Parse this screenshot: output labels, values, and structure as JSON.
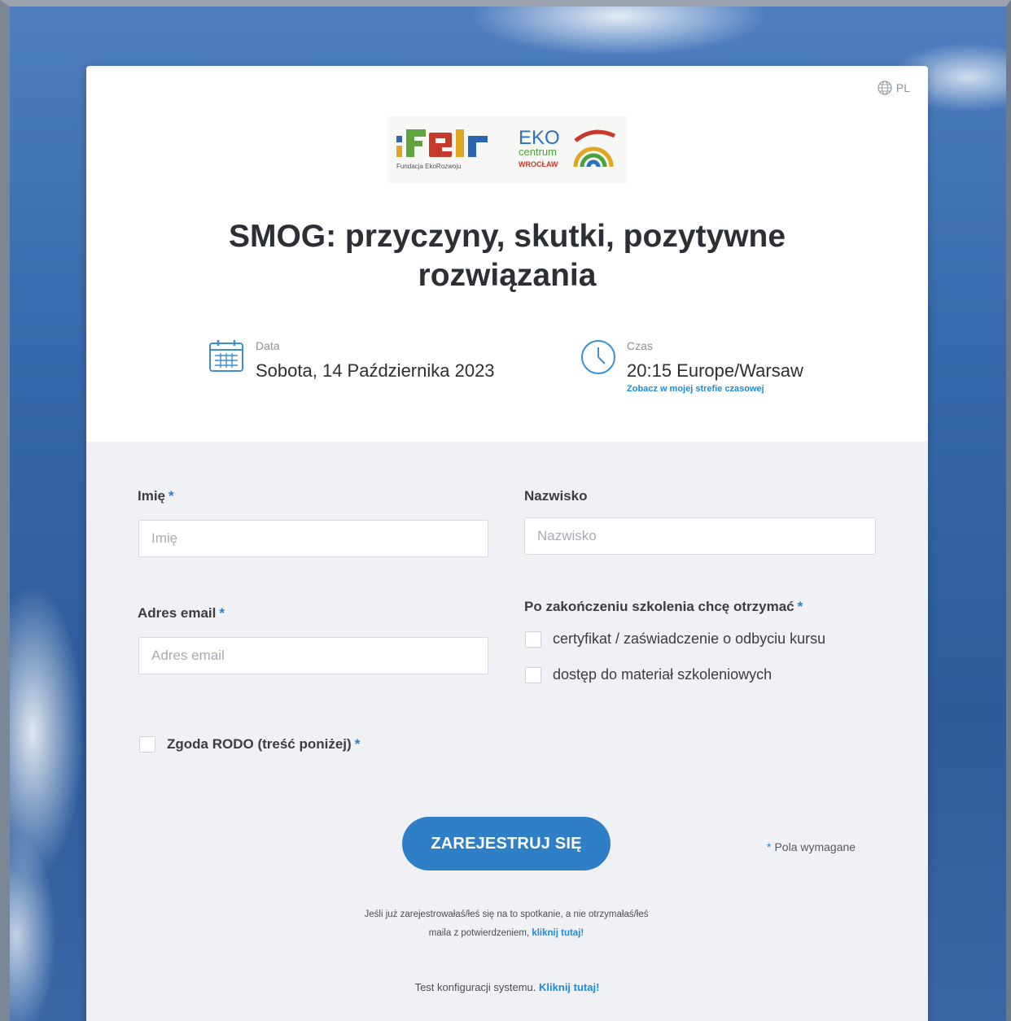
{
  "header": {
    "language": "PL",
    "logo_left_caption": "Fundacja EkoRozwoju",
    "logo_right_text": "EKO",
    "logo_right_sub": "centrum",
    "logo_right_city": "WROCŁAW"
  },
  "event": {
    "title": "SMOG: przyczyny, skutki, pozytywne rozwiązania",
    "date_label": "Data",
    "date_value": "Sobota, 14 Października 2023",
    "time_label": "Czas",
    "time_value": "20:15 Europe/Warsaw",
    "timezone_link": "Zobacz w mojej strefie czasowej"
  },
  "form": {
    "first_name": {
      "label": "Imię",
      "required": "*",
      "placeholder": "Imię",
      "value": ""
    },
    "last_name": {
      "label": "Nazwisko",
      "placeholder": "Nazwisko",
      "value": ""
    },
    "email": {
      "label": "Adres email",
      "required": "*",
      "placeholder": "Adres email",
      "value": ""
    },
    "after_training": {
      "label": "Po zakończeniu szkolenia chcę otrzymać",
      "required": "*",
      "options": [
        "certyfikat / zaświadczenie o odbyciu kursu",
        "dostęp do materiał szkoleniowych"
      ]
    },
    "consent": {
      "label": "Zgoda RODO (treść poniżej)",
      "required": "*"
    },
    "submit_label": "ZAREJESTRUJ SIĘ",
    "required_note_star": "*",
    "required_note": "Pola wymagane"
  },
  "footer": {
    "already_registered": "Jeśli już zarejestrowałaś/łeś się na to spotkanie, a nie otrzymałaś/łeś maila z potwierdzeniem,",
    "already_registered_link": "kliknij tutaj!",
    "system_test": "Test konfiguracji systemu.",
    "system_test_link": "Kliknij tutaj!"
  },
  "colors": {
    "accent": "#2f7fc7",
    "link": "#1a8be0",
    "form_bg": "#f0f1f5"
  }
}
